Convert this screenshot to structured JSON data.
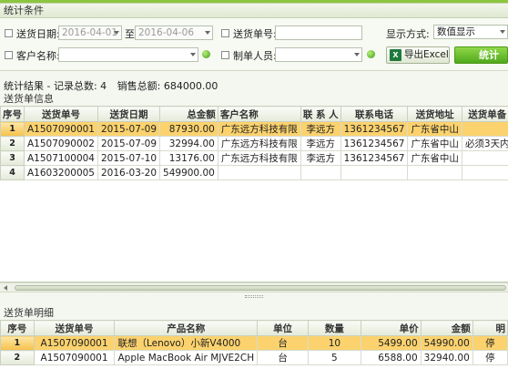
{
  "conditions": {
    "title": "统计条件",
    "ship_date_label": "送货日期:",
    "date_from": "2016-04-01",
    "date_to_label": "至",
    "date_to": "2016-04-06",
    "ship_no_label": "送货单号:",
    "ship_no_value": "",
    "display_label": "显示方式:",
    "display_value": "数值显示",
    "customer_label": "客户名称:",
    "customer_value": "",
    "maker_label": "制单人员:",
    "maker_value": "",
    "export_label": "导出Excel",
    "export_icon_text": "X",
    "stat_label": "统计"
  },
  "summary": {
    "result_label": "统计结果 - 记录总数: 4",
    "total_label": "销售总额: 684000.00"
  },
  "orders": {
    "title": "送货单信息",
    "columns": [
      "序号",
      "送货单号",
      "送货日期",
      "总金额",
      "客户名称",
      "联 系 人",
      "联系电话",
      "送货地址",
      "送货单备"
    ],
    "rows": [
      [
        "1",
        "A1507090001",
        "2015-07-09",
        "87930.00",
        "广东远方科技有限",
        "李远方",
        "1361234567",
        "广东省中山",
        ""
      ],
      [
        "2",
        "A1507090002",
        "2015-07-09",
        "32994.00",
        "广东远方科技有限",
        "李远方",
        "1361234567",
        "广东省中山",
        "必须3天内"
      ],
      [
        "3",
        "A1507100004",
        "2015-07-10",
        "13176.00",
        "广东远方科技有限",
        "李远方",
        "1361234567",
        "广东省中山",
        ""
      ],
      [
        "4",
        "A1603200005",
        "2016-03-20",
        "549900.00",
        "",
        "",
        "",
        "",
        ""
      ]
    ]
  },
  "details": {
    "title": "送货单明细",
    "columns": [
      "序号",
      "送货单号",
      "产品名称",
      "单位",
      "数量",
      "单价",
      "金额",
      "明"
    ],
    "rows": [
      [
        "1",
        "A1507090001",
        "联想（Lenovo）小新V4000",
        "台",
        "10",
        "5499.00",
        "54990.00",
        "停"
      ],
      [
        "2",
        "A1507090001",
        "Apple MacBook Air MJVE2CH",
        "台",
        "5",
        "6588.00",
        "32940.00",
        "停"
      ]
    ]
  }
}
